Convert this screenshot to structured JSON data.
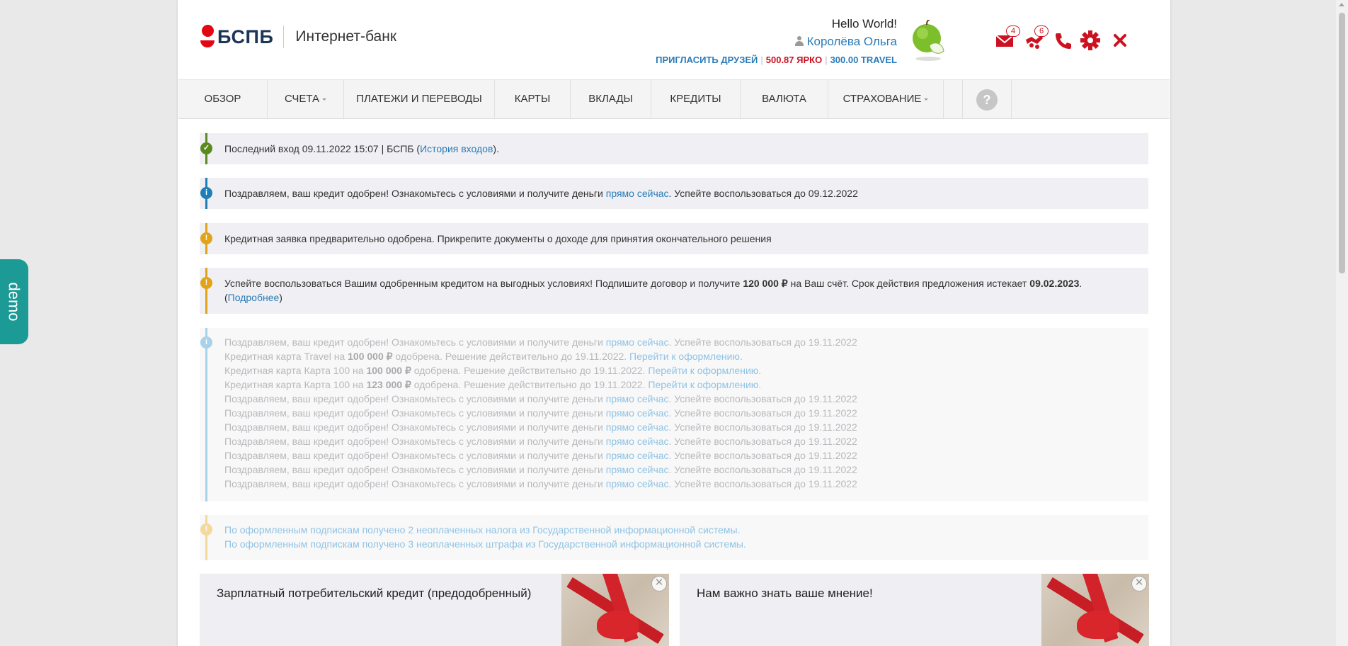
{
  "header": {
    "brand": "БСПБ",
    "product": "Интернет-банк",
    "greeting": "Hello World!",
    "user_name": "Королёва Ольга",
    "invite_label": "ПРИГЛАСИТЬ ДРУЗЕЙ",
    "bonus_yarko": "500.87 ЯРКО",
    "bonus_travel": "300.00 TRAVEL",
    "messages_count": "4",
    "offers_count": "6",
    "colors": {
      "brand_red": "#e30613",
      "link_blue": "#2a7bb8",
      "icon_red": "#cc1120"
    },
    "icons": [
      "mail-icon",
      "offers-icon",
      "phone-icon",
      "settings-icon",
      "logout-icon"
    ]
  },
  "nav": {
    "items": [
      {
        "label": "Обзор"
      },
      {
        "label": "Счета"
      },
      {
        "label": "Платежи и переводы"
      },
      {
        "label": "Карты"
      },
      {
        "label": "Вклады"
      },
      {
        "label": "Кредиты"
      },
      {
        "label": "Валюта"
      },
      {
        "label": "Страхование"
      }
    ],
    "help": "?"
  },
  "demo_label": "demo",
  "notices": {
    "last_login": {
      "text": "Последний вход 09.11.2022 15:07 | БСПБ (",
      "link": "История входов",
      "suffix": ")."
    },
    "credit_approved": {
      "text": "Поздравляем, ваш кредит одобрен! Ознакомьтесь с условиями и получите деньги ",
      "link": "прямо сейчас",
      "suffix": ". Успейте воспользоваться до 09.12.2022"
    },
    "pre_approved": {
      "text": "Кредитная заявка предварительно одобрена. Прикрепите документы о доходе для принятия окончательного решения"
    },
    "offer": {
      "text1": "Успейте воспользоваться Вашим одобренным кредитом на выгодных условиях! Подпишите договор и получите ",
      "amount": "120 000 ₽",
      "text2": " на Ваш счёт. Срок действия предложения истекает ",
      "date": "09.02.2023",
      "text3": ".",
      "open": "(",
      "link": "Подробнее",
      "close": ")"
    },
    "faded_group": {
      "congrats_text": "Поздравляем, ваш кредит одобрен! Ознакомьтесь с условиями и получите деньги ",
      "congrats_link": "прямо сейчас",
      "congrats_suffix": ". Успейте воспользоваться до 19.11.2022",
      "card_travel": {
        "prefix": "Кредитная карта Travel на ",
        "amount": "100 000 ₽",
        "suffix": " одобрена. Решение действительно до 19.11.2022. ",
        "link": "Перейти к оформлению",
        "end": "."
      },
      "card_100a": {
        "prefix": "Кредитная карта Карта 100 на ",
        "amount": "100 000 ₽",
        "suffix": " одобрена. Решение действительно до 19.11.2022. ",
        "link": "Перейти к оформлению",
        "end": "."
      },
      "card_100b": {
        "prefix": "Кредитная карта Карта 100 на ",
        "amount": "123 000 ₽",
        "suffix": " одобрена. Решение действительно до 19.11.2022. ",
        "link": "Перейти к оформлению",
        "end": "."
      }
    },
    "subscriptions": {
      "line1": "По оформленным подпискам получено 2 неоплаченных налога из Государственной информационной системы.",
      "line2": "По оформленным подпискам получено 3 неоплаченных штрафа из Государственной информационной системы."
    }
  },
  "promos": [
    {
      "title": "Зарплатный потребительский кредит (предодобренный)"
    },
    {
      "title": "Нам важно знать ваше мнение!"
    }
  ]
}
